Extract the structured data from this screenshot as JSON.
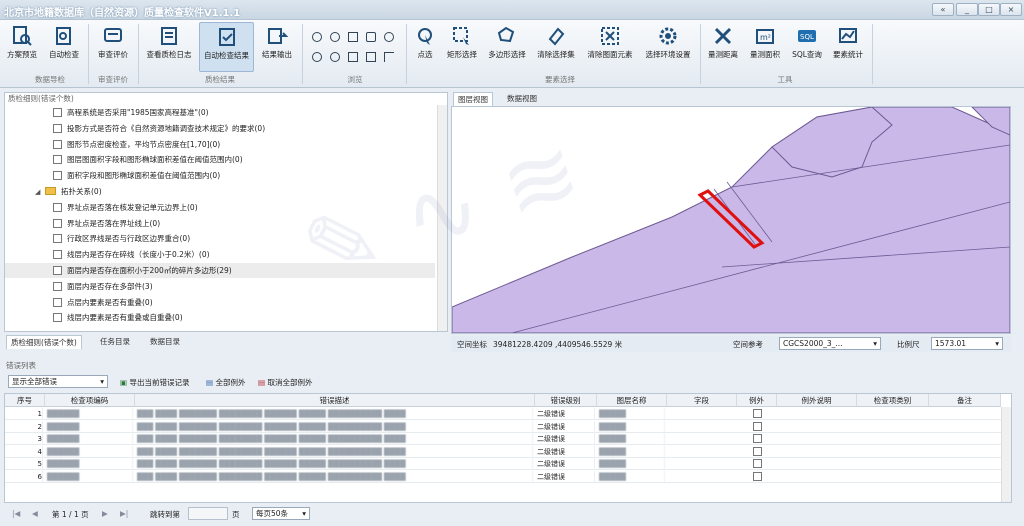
{
  "app": {
    "title": "北京市地籍数据库（自然资源）质量检查软件V1.1.1"
  },
  "window_buttons": [
    "«",
    "_",
    "□",
    "×"
  ],
  "ribbon": {
    "groups": [
      {
        "label": "数据导检"
      },
      {
        "label": "审查评价"
      },
      {
        "label": "质检结果"
      },
      {
        "label": "浏览"
      },
      {
        "label": "要素选择"
      },
      {
        "label": "工具"
      }
    ],
    "buttons": [
      "方案预览",
      "自动检查",
      "审查评价",
      "查看质检日志",
      "自动检查结果",
      "结果输出",
      "点选",
      "矩形选择",
      "多边形选择",
      "清除选择集",
      "清除图面元素",
      "选择环境设置",
      "量测距离",
      "量测面积",
      "SQL查询",
      "要素统计"
    ]
  },
  "left_panel": {
    "title": "质检细则(错误个数)",
    "rows": [
      {
        "text": "高程系统是否采用\"1985国家高程基准\"(0)",
        "indent": 2
      },
      {
        "text": "投影方式是否符合《自然资源地籍调查技术规定》的要求(0)",
        "indent": 2
      },
      {
        "text": "图形节点密度检查，平均节点密度在[1,70](0)",
        "indent": 2
      },
      {
        "text": "图层图面积字段和图形椭球面积差值在阈值范围内(0)",
        "indent": 2
      },
      {
        "text": "面积字段和图形椭球面积差值在阈值范围内(0)",
        "indent": 2
      },
      {
        "text": "拓扑关系(0)",
        "indent": 1,
        "folder": true
      },
      {
        "text": "界址点是否落在核发登记单元边界上(0)",
        "indent": 2
      },
      {
        "text": "界址点是否落在界址线上(0)",
        "indent": 2
      },
      {
        "text": "行政区界线是否与行政区边界重合(0)",
        "indent": 2
      },
      {
        "text": "线层内是否存在碎线（长度小于0.2米）(0)",
        "indent": 2
      },
      {
        "text": "面层内是否存在面积小于200㎡的碎片多边形(29)",
        "indent": 2,
        "hl": true
      },
      {
        "text": "面层内是否存在多部件(3)",
        "indent": 2
      },
      {
        "text": "点层内要素是否有重叠(0)",
        "indent": 2
      },
      {
        "text": "线层内要素是否有重叠或自重叠(0)",
        "indent": 2
      }
    ],
    "tabs": [
      "质检细则(错误个数)",
      "任务目录",
      "数据目录"
    ]
  },
  "map": {
    "tabs": [
      "图层视图",
      "数据视图"
    ],
    "coord_label": "空间坐标",
    "coord_value": "39481228.4209 ,4409546.5529 米",
    "ref_label": "空间参考",
    "ref_value": "CGCS2000_3_...",
    "scale_label": "比例尺",
    "scale_value": "1573.01",
    "colors": {
      "parcel": "#c9b8e8",
      "edge": "#6e5a93",
      "highlight": "#e01010"
    }
  },
  "errors": {
    "title": "错误列表",
    "filter": "显示全部错误",
    "actions": [
      "导出当前错误记录",
      "全部例外",
      "取消全部例外"
    ],
    "columns": [
      "序号",
      "检查项编码",
      "错误描述",
      "错误级别",
      "图层名称",
      "字段",
      "例外",
      "例外说明",
      "检查项类别",
      "备注"
    ],
    "rows": [
      {
        "no": "1",
        "code": "██████",
        "desc": "███ ████ ███████ ████████ ██████ █████ ██████████ ████",
        "level": "二级错误",
        "layer": "█████"
      },
      {
        "no": "2",
        "code": "██████",
        "desc": "███ ████ ███████ ████████ ██████ █████ ██████████ ████",
        "level": "二级错误",
        "layer": "█████"
      },
      {
        "no": "3",
        "code": "██████",
        "desc": "███ ████ ███████ ████████ ██████ █████ ██████████ ████",
        "level": "二级错误",
        "layer": "█████"
      },
      {
        "no": "4",
        "code": "██████",
        "desc": "███ ████ ███████ ████████ ██████ █████ ██████████ ████",
        "level": "二级错误",
        "layer": "█████"
      },
      {
        "no": "5",
        "code": "██████",
        "desc": "███ ████ ███████ ████████ ██████ █████ ██████████ ████",
        "level": "二级错误",
        "layer": "█████"
      },
      {
        "no": "6",
        "code": "██████",
        "desc": "███ ████ ███████ ████████ ██████ █████ ██████████ ████",
        "level": "二级错误",
        "layer": "█████"
      }
    ]
  },
  "pager": {
    "page": "第 1 / 1 页",
    "jump": "跳转到第",
    "page_unit": "页",
    "per_page": "每页50条"
  }
}
